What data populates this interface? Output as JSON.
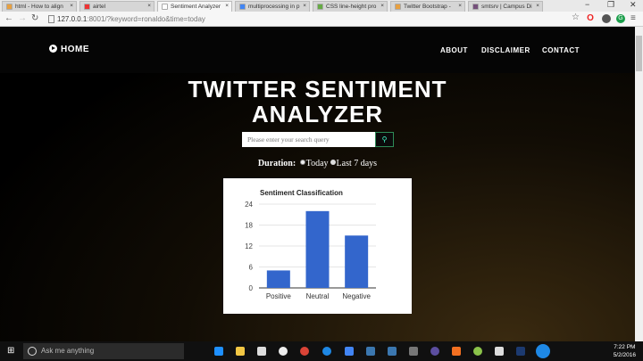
{
  "browser": {
    "tabs": [
      {
        "label": "html - How to align",
        "color": "#e8a040",
        "active": false
      },
      {
        "label": "airtel",
        "color": "#e33",
        "active": false
      },
      {
        "label": "Sentiment Analyzer",
        "color": "#fff",
        "active": true
      },
      {
        "label": "multiprocessing in p",
        "color": "#4285f4",
        "active": false
      },
      {
        "label": "CSS line-height pro",
        "color": "#6a4",
        "active": false
      },
      {
        "label": "Twitter Bootstrap -",
        "color": "#e8a040",
        "active": false
      },
      {
        "label": "smtsrv | Campus Di",
        "color": "#75507b",
        "active": false
      }
    ],
    "url_host": "127.0.0.1",
    "url_rest": ":8001/?keyword=ronaldo&time=today"
  },
  "nav": {
    "home": "HOME",
    "links": [
      "ABOUT",
      "DISCLAIMER",
      "CONTACT"
    ]
  },
  "title_line1": "TWITTER SENTIMENT",
  "title_line2": "ANALYZER",
  "search": {
    "placeholder": "Please enter your search query",
    "value": ""
  },
  "duration": {
    "label": "Duration:",
    "options": [
      "Today",
      "Last 7 days"
    ],
    "selected": "Today"
  },
  "chart_data": {
    "type": "bar",
    "title": "Sentiment Classification",
    "categories": [
      "Positive",
      "Neutral",
      "Negative"
    ],
    "values": [
      5,
      22,
      15
    ],
    "ylim": [
      0,
      24
    ],
    "yticks": [
      0,
      6,
      12,
      18,
      24
    ],
    "color": "#3366cc",
    "grid": true
  },
  "taskbar": {
    "search_placeholder": "Ask me anything",
    "time": "7:22 PM",
    "date": "5/2/2016"
  }
}
